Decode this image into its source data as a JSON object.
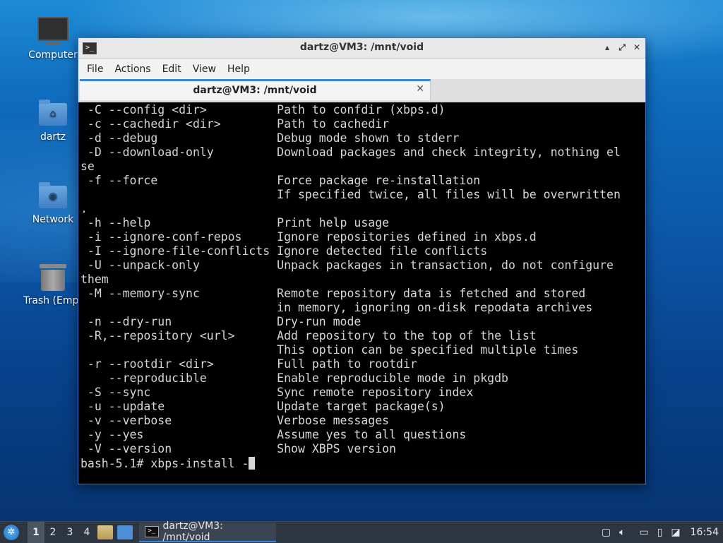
{
  "desktop": {
    "icons": [
      {
        "label": "Computer"
      },
      {
        "label": "dartz"
      },
      {
        "label": "Network"
      },
      {
        "label": "Trash (Empt"
      }
    ]
  },
  "window": {
    "title": "dartz@VM3: /mnt/void",
    "controls": {
      "minimize": "▴",
      "restore": "⤢",
      "close": "✕"
    },
    "menu": [
      "File",
      "Actions",
      "Edit",
      "View",
      "Help"
    ],
    "tab": {
      "label": "dartz@VM3: /mnt/void",
      "close": "✕"
    },
    "terminal_lines": [
      " -C --config <dir>          Path to confdir (xbps.d)",
      " -c --cachedir <dir>        Path to cachedir",
      " -d --debug                 Debug mode shown to stderr",
      " -D --download-only         Download packages and check integrity, nothing el",
      "se",
      " -f --force                 Force package re-installation",
      "                            If specified twice, all files will be overwritten",
      ".",
      " -h --help                  Print help usage",
      " -i --ignore-conf-repos     Ignore repositories defined in xbps.d",
      " -I --ignore-file-conflicts Ignore detected file conflicts",
      " -U --unpack-only           Unpack packages in transaction, do not configure",
      "them",
      " -M --memory-sync           Remote repository data is fetched and stored",
      "                            in memory, ignoring on-disk repodata archives",
      " -n --dry-run               Dry-run mode",
      " -R,--repository <url>      Add repository to the top of the list",
      "                            This option can be specified multiple times",
      " -r --rootdir <dir>         Full path to rootdir",
      "    --reproducible          Enable reproducible mode in pkgdb",
      " -S --sync                  Sync remote repository index",
      " -u --update                Update target package(s)",
      " -v --verbose               Verbose messages",
      " -y --yes                   Assume yes to all questions",
      " -V --version               Show XBPS version"
    ],
    "prompt": "bash-5.1# xbps-install -"
  },
  "taskbar": {
    "workspaces": [
      "1",
      "2",
      "3",
      "4"
    ],
    "active_workspace": "1",
    "task_label": "dartz@VM3: /mnt/void",
    "clock": "16:54"
  }
}
